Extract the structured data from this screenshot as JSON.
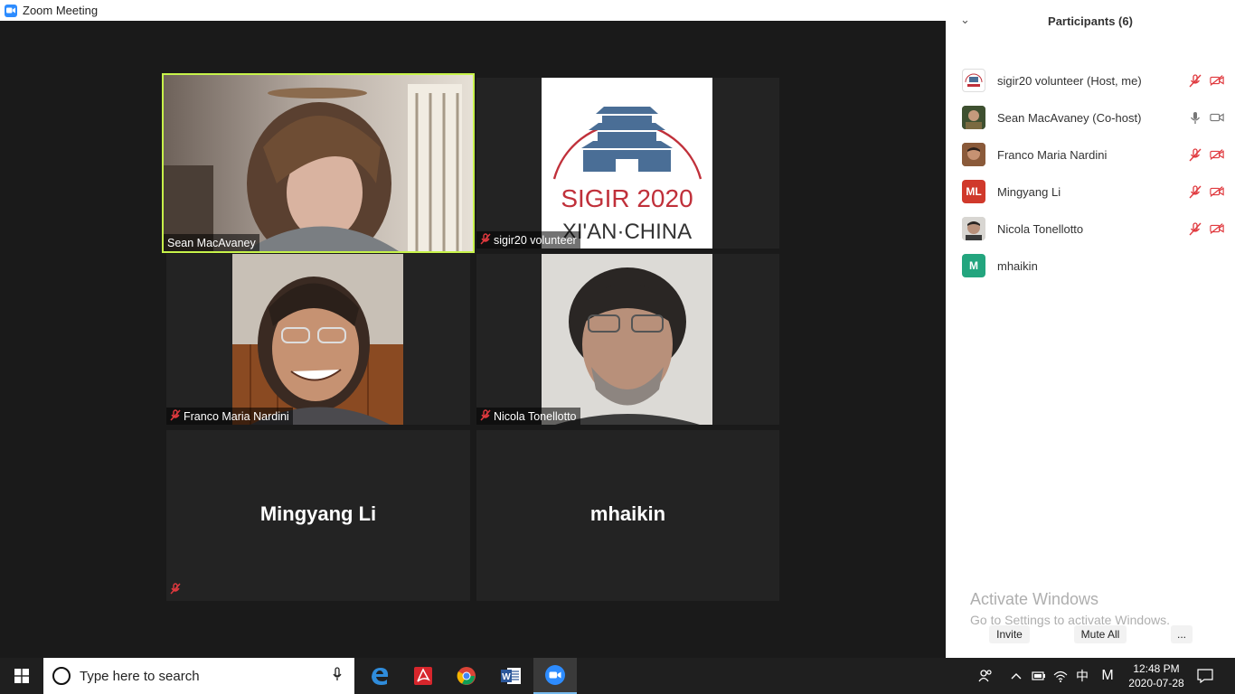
{
  "window": {
    "title": "Zoom Meeting"
  },
  "window_controls": {
    "minimize": "—",
    "restore": "❐",
    "close": "✕"
  },
  "tiles": [
    {
      "name": "Sean MacAvaney",
      "muted": false,
      "active": true
    },
    {
      "name": "sigir20 volunteer",
      "muted": true
    },
    {
      "name": "Franco Maria Nardini",
      "muted": true
    },
    {
      "name": "Nicola Tonellotto",
      "muted": true
    },
    {
      "name": "Mingyang Li",
      "muted": true
    },
    {
      "name": "mhaikin",
      "muted": false
    }
  ],
  "logo": {
    "line1": "SIGIR 2020",
    "line2": "XI'AN·CHINA",
    "color": "#c0303a",
    "building_color": "#4a6e96"
  },
  "panel": {
    "chevron": "⌄",
    "title": "Participants (6)",
    "participants": [
      {
        "name": "sigir20 volunteer (Host, me)",
        "mic": "muted",
        "video": "off",
        "avatar": "sigir-logo"
      },
      {
        "name": "Sean MacAvaney (Co-host)",
        "mic": "on",
        "video": "on",
        "avatar": "photo"
      },
      {
        "name": "Franco Maria Nardini",
        "mic": "muted",
        "video": "off",
        "avatar": "photo"
      },
      {
        "name": "Mingyang Li",
        "mic": "muted",
        "video": "off",
        "avatar": "initials",
        "initials": "ML",
        "color": "#d0392b"
      },
      {
        "name": "Nicola Tonellotto",
        "mic": "muted",
        "video": "off",
        "avatar": "photo"
      },
      {
        "name": "mhaikin",
        "mic": "none",
        "video": "none",
        "avatar": "initials",
        "initials": "M",
        "color": "#23a57e"
      }
    ],
    "buttons": {
      "invite": "Invite",
      "mute_all": "Mute All",
      "more": "..."
    }
  },
  "activate_windows": {
    "line1": "Activate Windows",
    "line2": "Go to Settings to activate Windows."
  },
  "taskbar": {
    "search_placeholder": "Type here to search",
    "apps": [
      "edge-icon",
      "acrobat-icon",
      "chrome-icon",
      "word-icon",
      "zoom-icon"
    ],
    "tray_ime": "中",
    "tray_m": "M",
    "time": "12:48 PM",
    "date": "2020-07-28"
  }
}
